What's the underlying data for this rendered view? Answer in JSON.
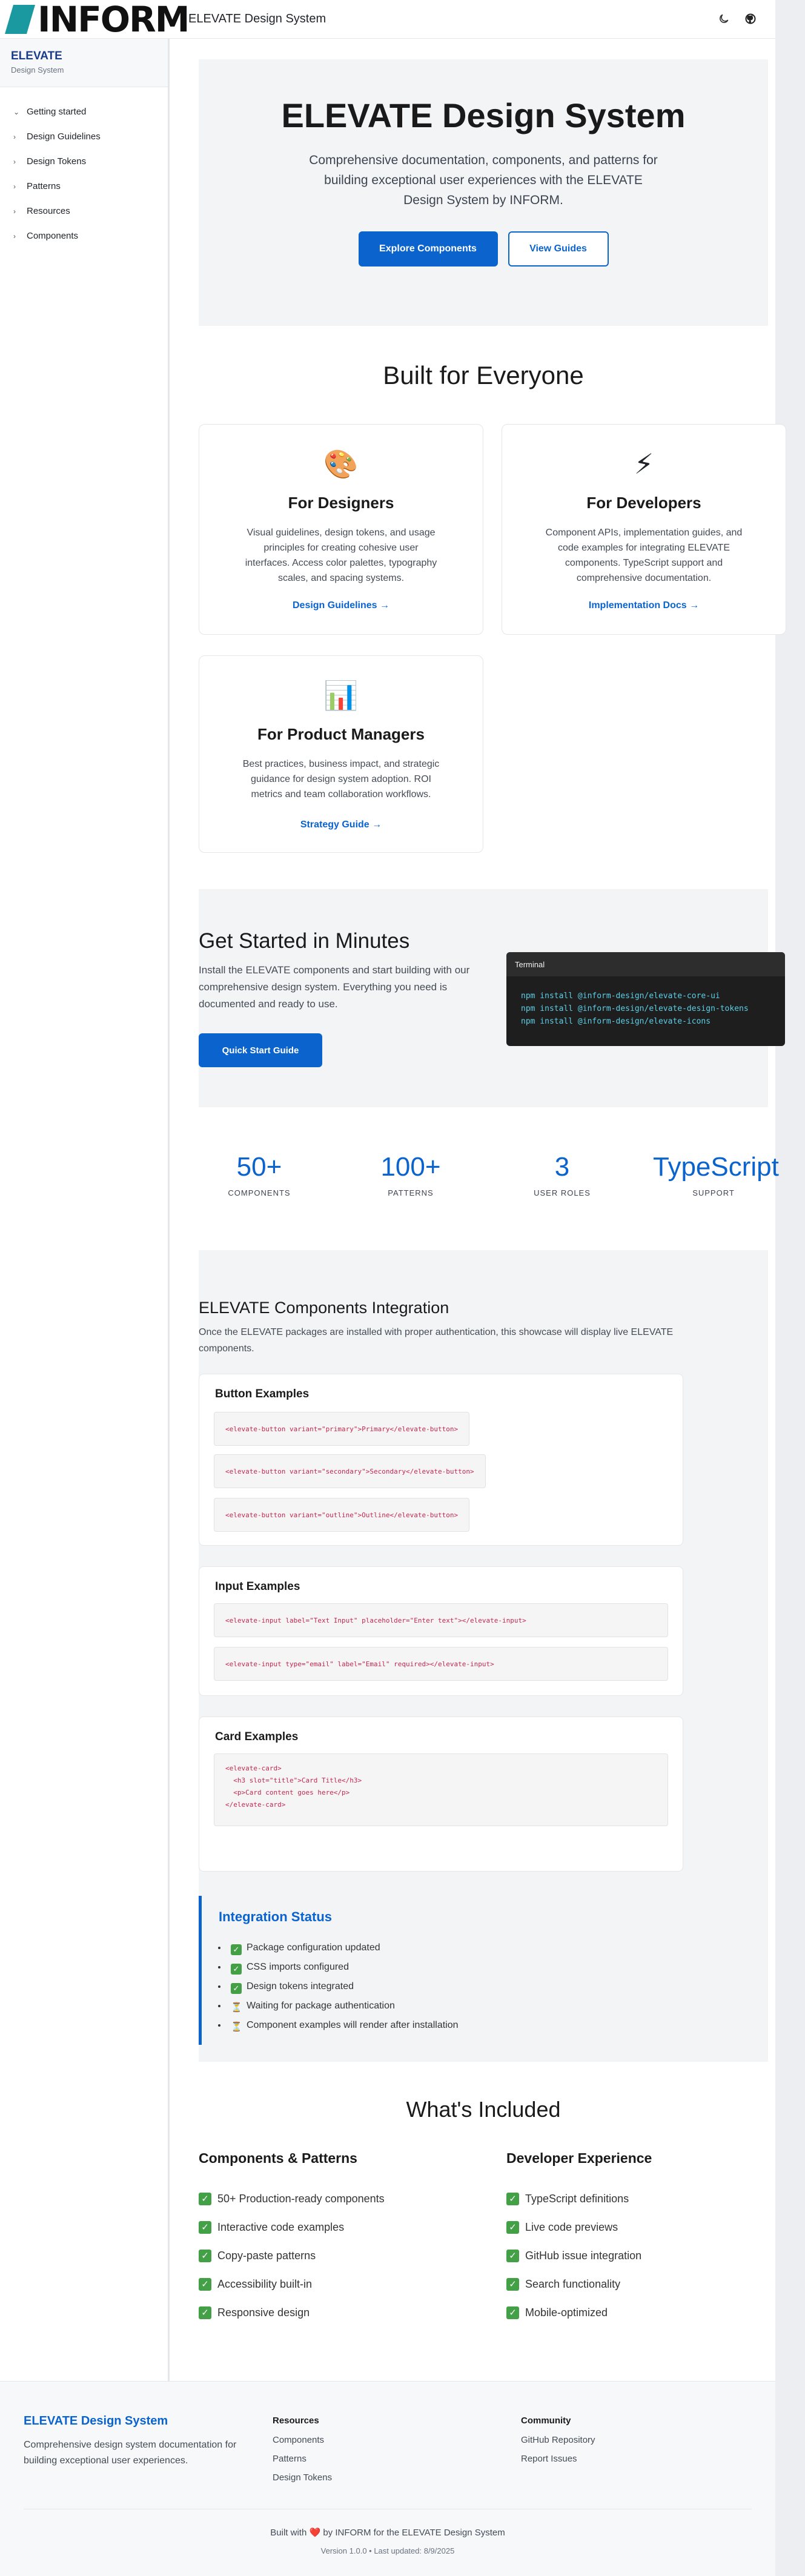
{
  "topbar": {
    "logo_text": "INFORM",
    "title": "ELEVATE Design System",
    "theme_icon": "moon-icon",
    "github_icon": "github-icon"
  },
  "sidebar": {
    "brand": "ELEVATE",
    "subtitle": "Design System",
    "items": [
      {
        "label": "Getting started",
        "expanded": true
      },
      {
        "label": "Design Guidelines",
        "expanded": false
      },
      {
        "label": "Design Tokens",
        "expanded": false
      },
      {
        "label": "Patterns",
        "expanded": false
      },
      {
        "label": "Resources",
        "expanded": false
      },
      {
        "label": "Components",
        "expanded": false
      }
    ]
  },
  "hero": {
    "title": "ELEVATE Design System",
    "description": "Comprehensive documentation, components, and patterns for building exceptional user experiences with the ELEVATE Design System by INFORM.",
    "primary_button": "Explore Components",
    "secondary_button": "View Guides"
  },
  "audience": {
    "title": "Built for Everyone",
    "cards": [
      {
        "icon": "palette-icon",
        "emoji": "🎨",
        "title": "For Designers",
        "text": "Visual guidelines, design tokens, and usage principles for creating cohesive user interfaces. Access color palettes, typography scales, and spacing systems.",
        "link": "Design Guidelines →"
      },
      {
        "icon": "lightning-icon",
        "emoji": "⚡",
        "title": "For Developers",
        "text": "Component APIs, implementation guides, and code examples for integrating ELEVATE components. TypeScript support and comprehensive documentation.",
        "link": "Implementation Docs →"
      },
      {
        "icon": "chart-icon",
        "emoji": "📊",
        "title": "For Product Managers",
        "text": "Best practices, business impact, and strategic guidance for design system adoption. ROI metrics and team collaboration workflows.",
        "link": "Strategy Guide →"
      }
    ]
  },
  "get_started": {
    "title": "Get Started in Minutes",
    "text": "Install the ELEVATE components and start building with our comprehensive design system. Everything you need is documented and ready to use.",
    "button": "Quick Start Guide",
    "terminal_title": "Terminal",
    "commands": [
      "npm install @inform-design/elevate-core-ui",
      "npm install @inform-design/elevate-design-tokens",
      "npm install @inform-design/elevate-icons"
    ]
  },
  "stats": [
    {
      "value": "50+",
      "label": "COMPONENTS"
    },
    {
      "value": "100+",
      "label": "PATTERNS"
    },
    {
      "value": "3",
      "label": "USER ROLES"
    },
    {
      "value": "TypeScript",
      "label": "SUPPORT"
    }
  ],
  "integration": {
    "title": "ELEVATE Components Integration",
    "description": "Once the ELEVATE packages are installed with proper authentication, this showcase will display live ELEVATE components.",
    "button_examples": {
      "title": "Button Examples",
      "codes": [
        "<elevate-button variant=\"primary\">Primary</elevate-button>",
        "<elevate-button variant=\"secondary\">Secondary</elevate-button>",
        "<elevate-button variant=\"outline\">Outline</elevate-button>"
      ]
    },
    "input_examples": {
      "title": "Input Examples",
      "codes": [
        "<elevate-input label=\"Text Input\" placeholder=\"Enter text\"></elevate-input>",
        "<elevate-input type=\"email\" label=\"Email\" required></elevate-input>"
      ]
    },
    "card_examples": {
      "title": "Card Examples",
      "code": "<elevate-card>\n  <h3 slot=\"title\">Card Title</h3>\n  <p>Card content goes here</p>\n</elevate-card>"
    },
    "status": {
      "title": "Integration Status",
      "items": [
        {
          "state": "done",
          "text": "Package configuration updated"
        },
        {
          "state": "done",
          "text": "CSS imports configured"
        },
        {
          "state": "done",
          "text": "Design tokens integrated"
        },
        {
          "state": "wait",
          "text": "Waiting for package authentication"
        },
        {
          "state": "wait",
          "text": "Component examples will render after installation"
        }
      ]
    }
  },
  "included": {
    "title": "What's Included",
    "left": {
      "title": "Components & Patterns",
      "items": [
        "50+ Production-ready components",
        "Interactive code examples",
        "Copy-paste patterns",
        "Accessibility built-in",
        "Responsive design"
      ]
    },
    "right": {
      "title": "Developer Experience",
      "items": [
        "TypeScript definitions",
        "Live code previews",
        "GitHub issue integration",
        "Search functionality",
        "Mobile-optimized"
      ]
    }
  },
  "footer": {
    "brand": "ELEVATE Design System",
    "description": "Comprehensive design system documentation for building exceptional user experiences.",
    "resources_title": "Resources",
    "resources": [
      "Components",
      "Patterns",
      "Design Tokens"
    ],
    "community_title": "Community",
    "community": [
      "GitHub Repository",
      "Report Issues"
    ],
    "built_prefix": "Built with",
    "built_suffix": "by INFORM for the ELEVATE Design System",
    "version": "Version 1.0.0 • Last updated: 8/9/2025"
  },
  "colors": {
    "accent": "#0b63ce",
    "success": "#43a047",
    "terminal_bg": "#1e1e1e",
    "logo_teal": "#1a9aa0"
  }
}
